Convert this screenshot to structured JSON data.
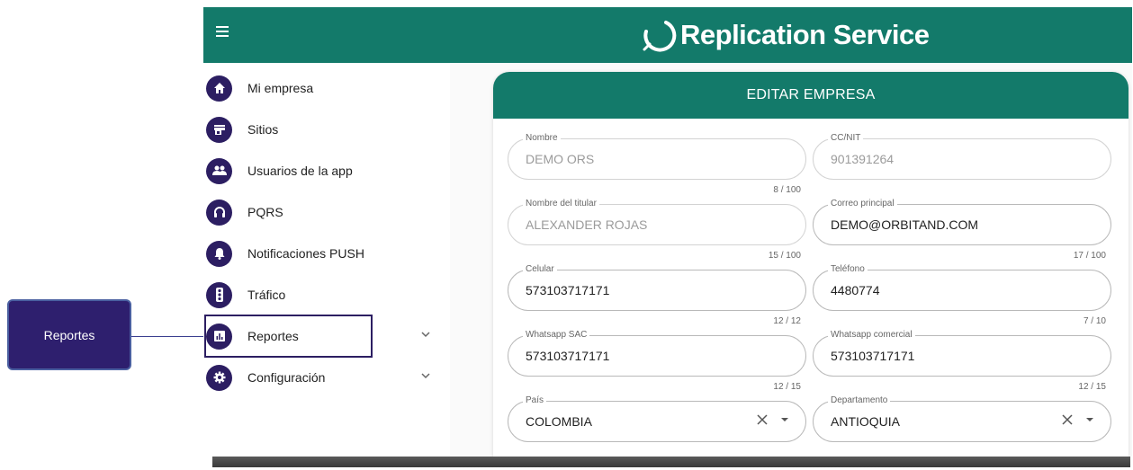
{
  "callout": {
    "label": "Reportes"
  },
  "app": {
    "title": "Replication Service"
  },
  "sidebar": {
    "items": [
      {
        "label": "Mi empresa",
        "icon": "home-icon"
      },
      {
        "label": "Sitios",
        "icon": "store-icon"
      },
      {
        "label": "Usuarios de la app",
        "icon": "users-icon"
      },
      {
        "label": "PQRS",
        "icon": "headset-icon"
      },
      {
        "label": "Notificaciones PUSH",
        "icon": "bell-icon"
      },
      {
        "label": "Tráfico",
        "icon": "traffic-light-icon"
      },
      {
        "label": "Reportes",
        "icon": "chart-icon",
        "expandable": true,
        "highlighted": true
      },
      {
        "label": "Configuración",
        "icon": "gear-icon",
        "expandable": true
      }
    ]
  },
  "form": {
    "title": "EDITAR EMPRESA",
    "fields": {
      "nombre": {
        "label": "Nombre",
        "value": "DEMO ORS",
        "counter": "8 / 100"
      },
      "ccnit": {
        "label": "CC/NIT",
        "value": "901391264"
      },
      "titular": {
        "label": "Nombre del titular",
        "value": "ALEXANDER ROJAS",
        "counter": "15 / 100"
      },
      "correo": {
        "label": "Correo principal",
        "value": "DEMO@ORBITAND.COM",
        "counter": "17 / 100"
      },
      "celular": {
        "label": "Celular",
        "value": "573103717171",
        "counter": "12 / 12"
      },
      "telefono": {
        "label": "Teléfono",
        "value": "4480774",
        "counter": "7 / 10"
      },
      "wsac": {
        "label": "Whatsapp SAC",
        "value": "573103717171",
        "counter": "12 / 15"
      },
      "wcomercial": {
        "label": "Whatsapp comercial",
        "value": "573103717171",
        "counter": "12 / 15"
      },
      "pais": {
        "label": "País",
        "value": "COLOMBIA"
      },
      "departamento": {
        "label": "Departamento",
        "value": "ANTIOQUIA"
      }
    }
  },
  "colors": {
    "primary": "#137a6a",
    "accent": "#2c1e62"
  }
}
